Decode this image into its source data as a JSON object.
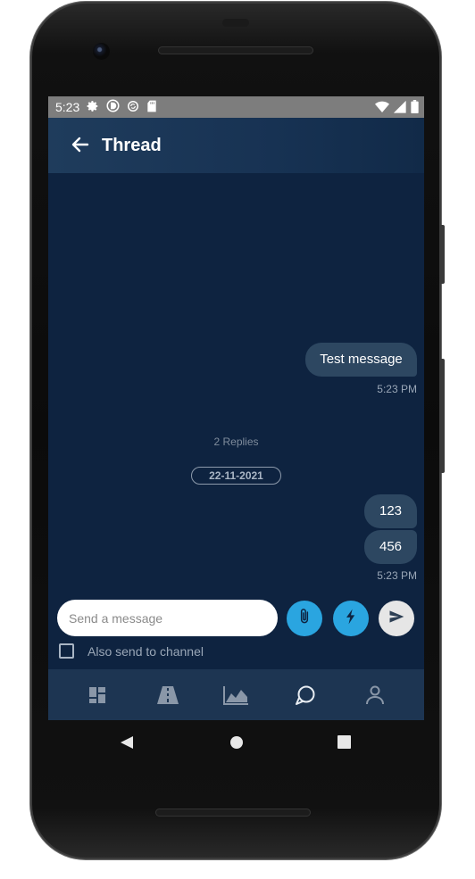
{
  "status_bar": {
    "time": "5:23",
    "left_icons": [
      "settings-icon",
      "d-app-icon",
      "sync-icon",
      "sd-card-icon"
    ],
    "right_icons": [
      "wifi-icon",
      "signal-icon",
      "battery-icon"
    ]
  },
  "app_bar": {
    "title": "Thread",
    "back_icon": "arrow-left-icon"
  },
  "messages": [
    {
      "text": "Test message",
      "time": "5:23 PM"
    },
    {
      "text": "123"
    },
    {
      "text": "456",
      "time": "5:23 PM"
    }
  ],
  "thread": {
    "replies_label": "2 Replies",
    "date_label": "22-11-2021"
  },
  "composer": {
    "placeholder": "Send a message",
    "value": "",
    "attach_icon": "paperclip-icon",
    "commands_icon": "lightning-icon",
    "send_icon": "send-icon",
    "also_send_label": "Also send to channel",
    "also_send_checked": false
  },
  "bottom_nav": [
    {
      "icon": "dashboard-icon",
      "active": false
    },
    {
      "icon": "road-icon",
      "active": false
    },
    {
      "icon": "area-chart-icon",
      "active": false
    },
    {
      "icon": "chat-icon",
      "active": true
    },
    {
      "icon": "person-icon",
      "active": false
    }
  ],
  "system_nav": [
    "back-triangle-icon",
    "home-circle-icon",
    "recents-square-icon"
  ],
  "colors": {
    "background": "#0e2340",
    "bubble": "#2d4761",
    "accent_blue": "#2aa5e0",
    "send_button": "#e6e6e6"
  }
}
